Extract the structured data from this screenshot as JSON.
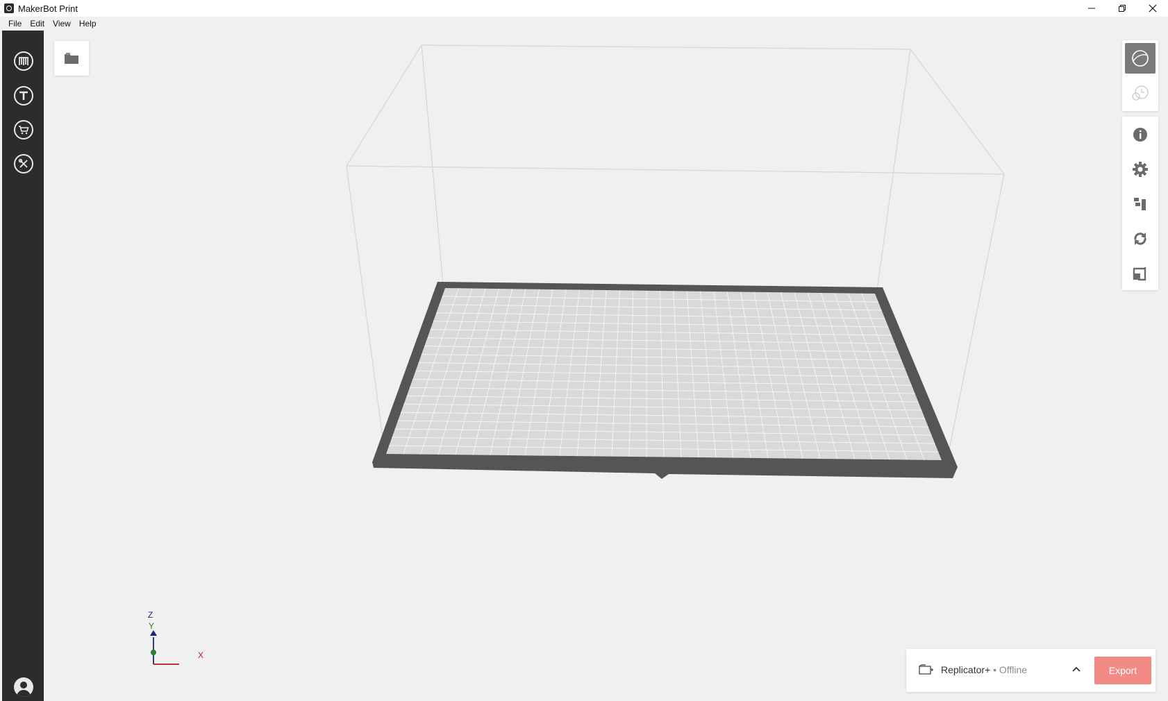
{
  "window": {
    "title": "MakerBot Print"
  },
  "menu": {
    "items": [
      "File",
      "Edit",
      "View",
      "Help"
    ]
  },
  "sidebar": {
    "items": [
      {
        "icon": "makerbot-logo-icon"
      },
      {
        "icon": "thingiverse-icon"
      },
      {
        "icon": "store-cart-icon"
      },
      {
        "icon": "utilities-icon"
      }
    ],
    "profile_icon": "user-avatar-icon"
  },
  "viewport": {
    "axis_labels": {
      "z": "Z",
      "y": "Y",
      "x": "X"
    },
    "colors": {
      "x_axis": "#b71c1c",
      "y_axis": "#2e7d32",
      "z_axis": "#1a237e",
      "plate_frame": "#555555",
      "plate_surface": "#d9d9d9"
    }
  },
  "right_toolbar": {
    "view_modes": [
      {
        "icon": "prepare-view-icon",
        "active": true
      },
      {
        "icon": "preview-clock-icon",
        "active": false
      }
    ],
    "tools": [
      {
        "icon": "info-icon"
      },
      {
        "icon": "settings-gear-icon"
      },
      {
        "icon": "arrange-icon"
      },
      {
        "icon": "rotate-icon"
      },
      {
        "icon": "scale-icon"
      }
    ]
  },
  "print_bar": {
    "printer_name": "Replicator+",
    "printer_status": " • Offline",
    "export_label": "Export",
    "export_color": "#f28a85"
  }
}
